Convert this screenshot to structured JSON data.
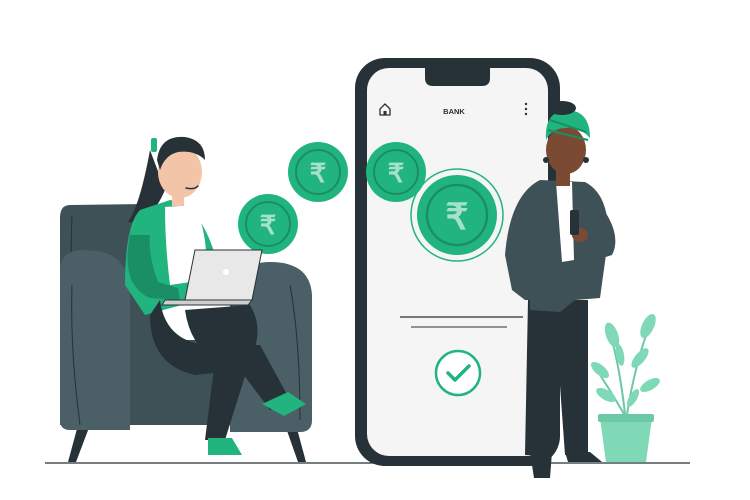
{
  "phone": {
    "header_title": "BANK",
    "home_icon": "home-icon",
    "menu_icon": "kebab-menu-icon",
    "confirm_icon": "check-circle-icon",
    "screen_color": "#f5f5f5",
    "frame_color": "#263238"
  },
  "coins": {
    "symbol": "₹",
    "icon": "rupee-coin-icon",
    "count": 4,
    "color": "#21b47f"
  },
  "colors": {
    "accent": "#21b47f",
    "accent_dark": "#1a8f65",
    "dark": "#263238",
    "armchair": "#3e5157",
    "plant_leaf": "#7fd9b7",
    "pot": "#7fd9b7"
  }
}
